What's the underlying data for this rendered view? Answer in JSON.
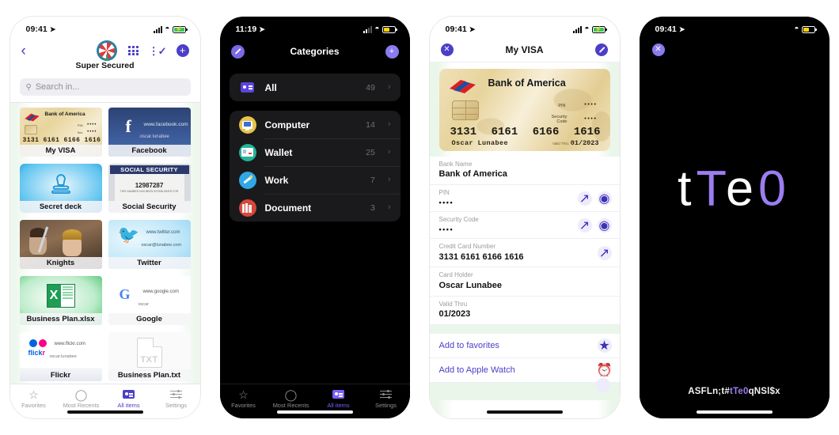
{
  "screen1": {
    "status": {
      "time": "09:41",
      "location_icon": "location-arrow",
      "signal": "signal-bars",
      "wifi": "wifi-icon",
      "battery": "battery-charging"
    },
    "nav": {
      "back_icon": "chevron-left-icon",
      "avatar_icon": "pinwheel-avatar",
      "grid_icon": "grid-icon",
      "select_icon": "checklist-icon",
      "add_icon": "plus-circle-icon"
    },
    "title": "Super Secured",
    "search": {
      "placeholder": "Search in...",
      "icon": "search-icon"
    },
    "items": [
      {
        "caption": "My VISA",
        "art": "bank-of-america-card",
        "bank": "Bank of America",
        "number": "3131 6161 6166 1616"
      },
      {
        "caption": "Facebook",
        "art": "facebook-card",
        "url": "www.facebook.com",
        "user": "oscar.lunabee"
      },
      {
        "caption": "Secret deck",
        "art": "secret-deck-card"
      },
      {
        "caption": "Social Security",
        "art": "social-security-card",
        "heading": "SOCIAL SECURITY",
        "ssn": "12987287",
        "fine": "THIS NUMBER HAS BEEN ESTABLISHED FOR"
      },
      {
        "caption": "Knights",
        "art": "knights-photo"
      },
      {
        "caption": "Twitter",
        "art": "twitter-card",
        "url": "www.twitter.com",
        "user": "oscar@lunabee.com"
      },
      {
        "caption": "Business Plan.xlsx",
        "art": "excel-file",
        "glyph": "X"
      },
      {
        "caption": "Google",
        "art": "google-card",
        "url": "www.google.com",
        "user": "oscar",
        "glyph": "G"
      },
      {
        "caption": "Flickr",
        "art": "flickr-card",
        "url": "www.flickr.com",
        "user": "oscar.lunabee",
        "wordmark": "flickr"
      },
      {
        "caption": "Business Plan.txt",
        "art": "text-file",
        "glyph": "TXT"
      }
    ],
    "tabs": [
      {
        "label": "Favorites",
        "icon": "star-icon",
        "active": false
      },
      {
        "label": "Most Recents",
        "icon": "clock-icon",
        "active": false
      },
      {
        "label": "All items",
        "icon": "wallet-icon",
        "active": true
      },
      {
        "label": "Settings",
        "icon": "sliders-icon",
        "active": false
      }
    ]
  },
  "screen2": {
    "status": {
      "time": "11:19",
      "location_icon": "location-arrow",
      "signal": "signal-bars-weak",
      "wifi": "wifi-icon",
      "battery": "battery-low"
    },
    "nav": {
      "edit_icon": "pencil-circle-icon",
      "title": "Categories",
      "add_icon": "plus-circle-icon"
    },
    "all_group": [
      {
        "name": "All",
        "count": "49",
        "icon": "wallet-icon",
        "chevron": "chevron-right-icon"
      }
    ],
    "categories": [
      {
        "name": "Computer",
        "count": "14",
        "icon": "computer-icon",
        "chevron": "chevron-right-icon"
      },
      {
        "name": "Wallet",
        "count": "25",
        "icon": "wallet-category-icon",
        "chevron": "chevron-right-icon"
      },
      {
        "name": "Work",
        "count": "7",
        "icon": "work-icon",
        "chevron": "chevron-right-icon"
      },
      {
        "name": "Document",
        "count": "3",
        "icon": "document-icon",
        "chevron": "chevron-right-icon"
      }
    ],
    "tabs": [
      {
        "label": "Favorites",
        "icon": "star-icon",
        "active": false
      },
      {
        "label": "Most Recents",
        "icon": "clock-icon",
        "active": false
      },
      {
        "label": "All items",
        "icon": "wallet-icon",
        "active": true
      },
      {
        "label": "Settings",
        "icon": "sliders-icon",
        "active": false
      }
    ]
  },
  "screen3": {
    "status": {
      "time": "09:41",
      "location_icon": "location-arrow",
      "signal": "signal-bars",
      "wifi": "wifi-icon",
      "battery": "battery-charging"
    },
    "nav": {
      "close_icon": "close-circle-icon",
      "title": "My VISA",
      "edit_icon": "pencil-circle-icon"
    },
    "card": {
      "bank": "Bank of America",
      "logo": "bank-of-america-flag-logo",
      "pin_label": "PIN",
      "pin_value": "••••",
      "security_label": "Security Code",
      "security_value": "••••",
      "number": [
        "3131",
        "6161",
        "6166",
        "1616"
      ],
      "holder": "Oscar  Lunabee",
      "valid_thru_label": "Valid Thru",
      "valid_thru": "01/2023"
    },
    "fields": [
      {
        "label": "Bank Name",
        "value": "Bank of America",
        "masked": false,
        "actions": []
      },
      {
        "label": "PIN",
        "value": "••••",
        "masked": true,
        "actions": [
          "expand-icon",
          "eye-icon"
        ]
      },
      {
        "label": "Security Code",
        "value": "••••",
        "masked": true,
        "actions": [
          "expand-icon",
          "eye-icon"
        ]
      },
      {
        "label": "Credit Card Number",
        "value": "3131 6161 6166 1616",
        "masked": false,
        "actions": [
          "expand-icon"
        ]
      },
      {
        "label": "Card Holder",
        "value": "Oscar Lunabee",
        "masked": false,
        "actions": []
      },
      {
        "label": "Valid Thru",
        "value": "01/2023",
        "masked": false,
        "actions": []
      }
    ],
    "actions": [
      {
        "label": "Add to favorites",
        "icon": "star-add-icon"
      },
      {
        "label": "Add to Apple Watch",
        "icon": "apple-watch-icon"
      }
    ]
  },
  "screen4": {
    "status": {
      "time": "09:41",
      "location_icon": "location-arrow",
      "wifi": "wifi-icon",
      "battery": "battery-low"
    },
    "close_icon": "close-circle-icon",
    "large_chars": [
      {
        "char": "t",
        "color": "white"
      },
      {
        "char": "T",
        "color": "purple"
      },
      {
        "char": "e",
        "color": "white"
      },
      {
        "char": "0",
        "color": "purple"
      }
    ],
    "full_password_parts": [
      {
        "text": "ASFLn;t#",
        "color": "white"
      },
      {
        "text": "tTe0",
        "color": "purple"
      },
      {
        "text": "qNSl$x",
        "color": "white"
      }
    ]
  },
  "colors": {
    "accent_purple": "#4b3fc7",
    "accent_light_purple": "#9b7df0",
    "page_background": "#ffffff",
    "dark_background": "#000000",
    "tint_green": "#eaf6ea"
  }
}
